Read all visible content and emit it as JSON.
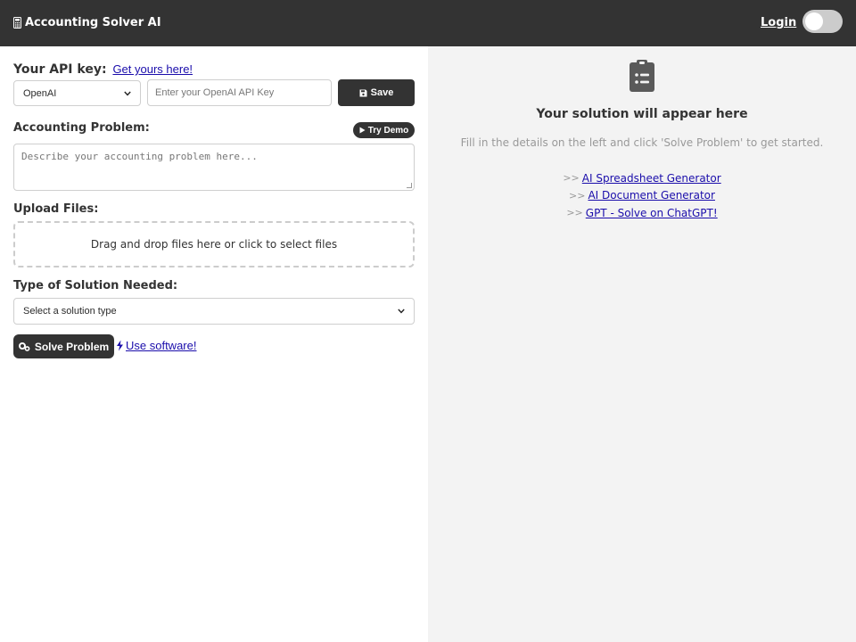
{
  "header": {
    "title": "Accounting Solver AI",
    "login_label": "Login",
    "calculator_icon": "calculator-icon",
    "theme_toggle": "theme-toggle"
  },
  "api_key": {
    "label": "Your API key:",
    "link_text": "Get yours here!",
    "provider_selected": "OpenAI",
    "input_placeholder": "Enter your OpenAI API Key",
    "save_label": "Save"
  },
  "problem": {
    "label": "Accounting Problem:",
    "demo_label": "Try Demo",
    "placeholder": "Describe your accounting problem here..."
  },
  "upload": {
    "label": "Upload Files:",
    "dropzone_text": "Drag and drop files here or click to select files"
  },
  "solution_type": {
    "label": "Type of Solution Needed:",
    "selected": "Select a solution type"
  },
  "actions": {
    "solve_label": "Solve Problem",
    "software_label": "Use software!"
  },
  "solution_panel": {
    "title": "Your solution will appear here",
    "subtitle": "Fill in the details on the left and click 'Solve Problem' to get started.",
    "links": [
      {
        "prefix": ">>",
        "label": "AI Spreadsheet Generator"
      },
      {
        "prefix": ">>",
        "label": "AI Document Generator"
      },
      {
        "prefix": ">>",
        "label": "GPT - Solve on ChatGPT!"
      }
    ]
  },
  "colors": {
    "header_bg": "#333333",
    "panel_bg": "#f3f3f3",
    "link": "#1a0dab",
    "button_bg": "#333333"
  }
}
